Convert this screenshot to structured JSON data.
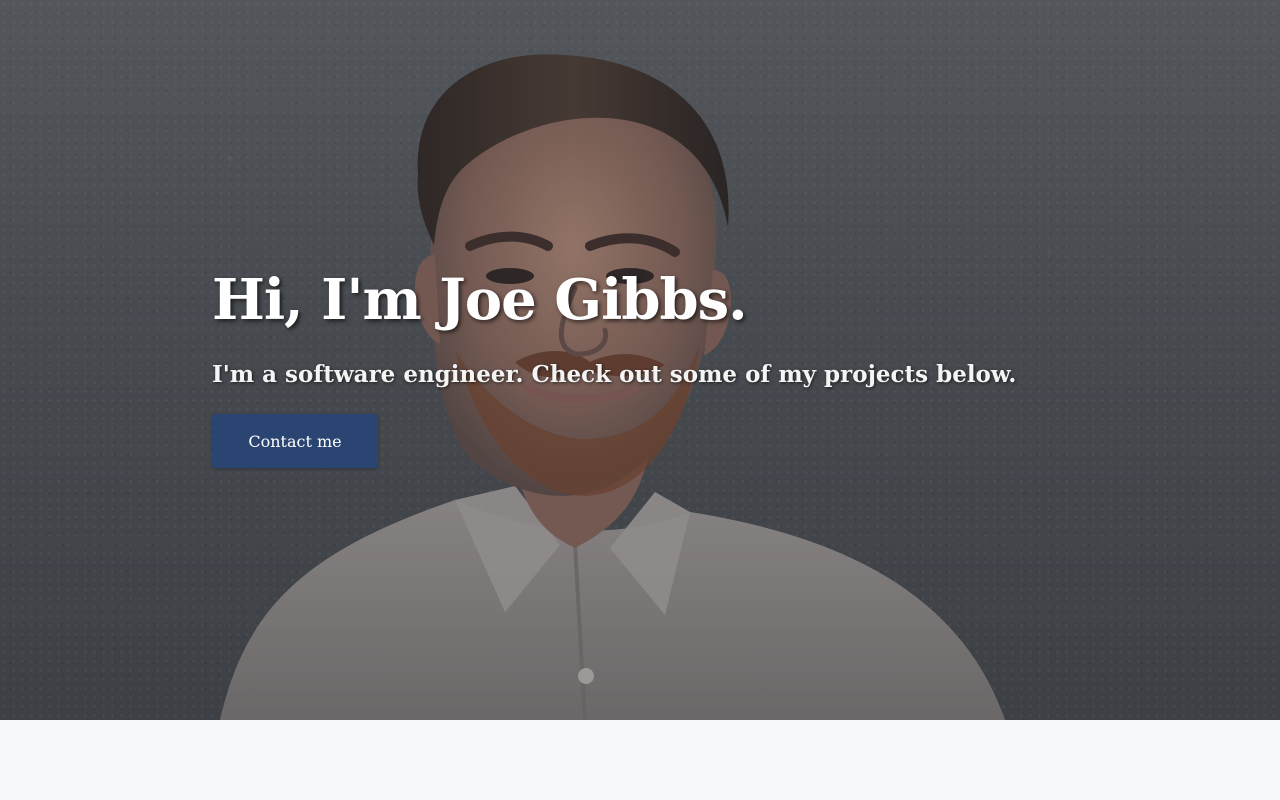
{
  "hero": {
    "headline": "Hi, I'm Joe Gibbs.",
    "subheadline": "I'm a software engineer. Check out some of my projects below.",
    "cta_label": "Contact me",
    "image_description_icon": "portrait-photo"
  },
  "colors": {
    "cta_background": "#2a4571",
    "page_background": "#f7f8fa",
    "hero_text": "#ffffff"
  }
}
